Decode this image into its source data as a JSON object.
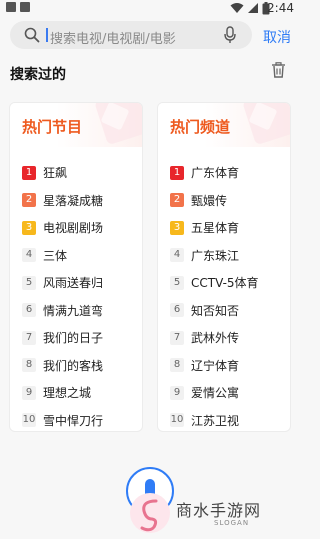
{
  "status_bar": {
    "time": "2:44",
    "icons": [
      "notification-square-icon",
      "notification-square-icon",
      "wifi-icon",
      "signal-icon",
      "battery-icon"
    ]
  },
  "search": {
    "placeholder": "搜索电视/电视剧/电影",
    "cancel_label": "取消",
    "icons": [
      "search-icon",
      "microphone-icon"
    ]
  },
  "history": {
    "title": "搜索过的",
    "clear_icon": "trash-icon"
  },
  "hot_programs": {
    "title": "热门节目",
    "items": [
      {
        "rank": "1",
        "label": "狂飙"
      },
      {
        "rank": "2",
        "label": "星落凝成糖"
      },
      {
        "rank": "3",
        "label": "电视剧剧场"
      },
      {
        "rank": "4",
        "label": "三体"
      },
      {
        "rank": "5",
        "label": "风雨送春归"
      },
      {
        "rank": "6",
        "label": "情满九道弯"
      },
      {
        "rank": "7",
        "label": "我们的日子"
      },
      {
        "rank": "8",
        "label": "我们的客栈"
      },
      {
        "rank": "9",
        "label": "理想之城"
      },
      {
        "rank": "10",
        "label": "雪中悍刀行"
      }
    ]
  },
  "hot_channels": {
    "title": "热门频道",
    "items": [
      {
        "rank": "1",
        "label": "广东体育"
      },
      {
        "rank": "2",
        "label": "甄嬛传"
      },
      {
        "rank": "3",
        "label": "五星体育"
      },
      {
        "rank": "4",
        "label": "广东珠江"
      },
      {
        "rank": "5",
        "label": "CCTV-5体育"
      },
      {
        "rank": "6",
        "label": "知否知否"
      },
      {
        "rank": "7",
        "label": "武林外传"
      },
      {
        "rank": "8",
        "label": "辽宁体育"
      },
      {
        "rank": "9",
        "label": "爱情公寓"
      },
      {
        "rank": "10",
        "label": "江苏卫视"
      }
    ]
  },
  "rank_colors": {
    "1": "#e8262b",
    "2": "#f2734a",
    "3": "#f7b81c",
    "default": "#f1f1f1"
  },
  "accent_color": "#2f7cf6",
  "watermark": {
    "text": "商水手游网",
    "sub": "SLOGAN"
  }
}
